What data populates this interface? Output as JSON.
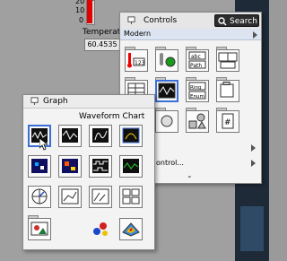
{
  "front_panel": {
    "scale_ticks": [
      "20",
      "10",
      "0"
    ],
    "indicator_label": "Temperat",
    "indicator_value": "60.4535",
    "fill_color": "#e00000"
  },
  "controls_palette": {
    "title": "Controls",
    "search_label": "Search",
    "category": "Modern",
    "footer_text": "ontrol...",
    "accent": "#3b6fd6",
    "icons": [
      {
        "name": "numeric-icon",
        "text": "123"
      },
      {
        "name": "boolean-icon",
        "text": ""
      },
      {
        "name": "string-path-icon",
        "text": "abc Path"
      },
      {
        "name": "array-cluster-icon",
        "text": ""
      },
      {
        "name": "list-table-icon",
        "text": ""
      },
      {
        "name": "graph-icon",
        "text": ""
      },
      {
        "name": "ring-enum-icon",
        "text": "Ring Enum"
      },
      {
        "name": "containers-icon",
        "text": ""
      },
      {
        "name": "io-icon",
        "text": ""
      },
      {
        "name": "refnum-icon",
        "text": ""
      },
      {
        "name": "decorations-icon",
        "text": ""
      },
      {
        "name": "variant-icon",
        "text": "#"
      }
    ]
  },
  "graph_palette": {
    "title": "Graph",
    "subtitle": "Waveform Chart",
    "icons": [
      {
        "name": "waveform-chart-icon"
      },
      {
        "name": "waveform-graph-icon"
      },
      {
        "name": "xy-graph-icon"
      },
      {
        "name": "ex-xy-graph-icon"
      },
      {
        "name": "intensity-chart-icon"
      },
      {
        "name": "intensity-graph-icon"
      },
      {
        "name": "digital-waveform-icon"
      },
      {
        "name": "mixed-signal-icon"
      },
      {
        "name": "compass-plot-icon"
      },
      {
        "name": "error-bar-icon"
      },
      {
        "name": "feather-plot-icon"
      },
      {
        "name": "xy-plot-matrix-icon"
      },
      {
        "name": "picture-icon"
      },
      {
        "name": "3d-scatter-icon"
      },
      {
        "name": "3d-surface-icon"
      }
    ]
  }
}
